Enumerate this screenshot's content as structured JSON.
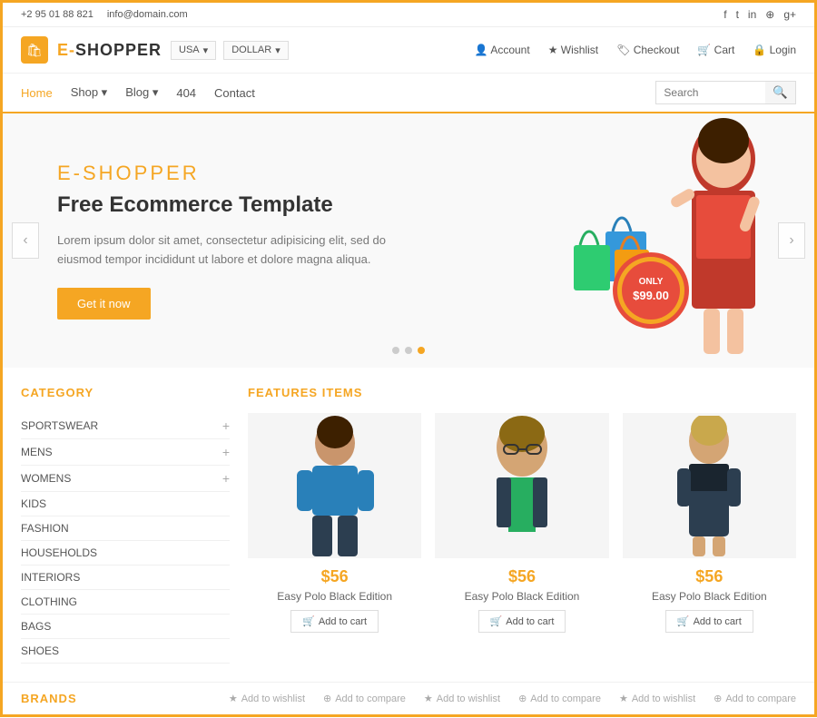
{
  "topbar": {
    "phone": "+2 95 01 88 821",
    "email": "info@domain.com",
    "social": [
      "f",
      "t",
      "in",
      "⊕",
      "g+"
    ]
  },
  "header": {
    "logo": "E-SHOPPER",
    "logo_prefix": "E-",
    "logo_suffix": "SHOPPER",
    "country": "USA",
    "currency": "DOLLAR",
    "nav": [
      {
        "label": "Account",
        "icon": "👤"
      },
      {
        "label": "Wishlist",
        "icon": "★"
      },
      {
        "label": "Checkout",
        "icon": "🏷"
      },
      {
        "label": "Cart",
        "icon": "🛒"
      },
      {
        "label": "Login",
        "icon": "🔒"
      }
    ]
  },
  "navbar": {
    "links": [
      {
        "label": "Home",
        "active": true
      },
      {
        "label": "Shop",
        "dropdown": true
      },
      {
        "label": "Blog",
        "dropdown": true
      },
      {
        "label": "404"
      },
      {
        "label": "Contact"
      }
    ],
    "search_placeholder": "Search"
  },
  "hero": {
    "brand": "E-SHOPPER",
    "title": "Free Ecommerce Template",
    "description": "Lorem ipsum dolor sit amet, consectetur adipisicing elit, sed do eiusmod tempor incididunt ut labore et dolore magna aliqua.",
    "cta": "Get it now",
    "price_label": "ONLY",
    "price": "$99.00",
    "dots": [
      1,
      2,
      3
    ],
    "active_dot": 3
  },
  "category": {
    "title": "CATEGORY",
    "items": [
      {
        "label": "SPORTSWEAR",
        "has_plus": true
      },
      {
        "label": "MENS",
        "has_plus": true
      },
      {
        "label": "WOMENS",
        "has_plus": true
      },
      {
        "label": "KIDS",
        "has_plus": false
      },
      {
        "label": "FASHION",
        "has_plus": false
      },
      {
        "label": "HOUSEHOLDS",
        "has_plus": false
      },
      {
        "label": "INTERIORS",
        "has_plus": false
      },
      {
        "label": "CLOTHING",
        "has_plus": false
      },
      {
        "label": "BAGS",
        "has_plus": false
      },
      {
        "label": "SHOES",
        "has_plus": false
      }
    ]
  },
  "featured": {
    "title": "FEATURES ITEMS",
    "products": [
      {
        "price": "$56",
        "name": "Easy Polo Black Edition",
        "cta": "Add to cart",
        "figure": "woman1"
      },
      {
        "price": "$56",
        "name": "Easy Polo Black Edition",
        "cta": "Add to cart",
        "figure": "man"
      },
      {
        "price": "$56",
        "name": "Easy Polo Black Edition",
        "cta": "Add to cart",
        "figure": "woman2"
      }
    ]
  },
  "bottom": {
    "brands_title": "BRANDS",
    "actions": [
      {
        "icon": "★",
        "label": "Add to wishlist"
      },
      {
        "icon": "⊕",
        "label": "Add to compare"
      },
      {
        "icon": "★",
        "label": "Add to wishlist"
      },
      {
        "icon": "⊕",
        "label": "Add to compare"
      },
      {
        "icon": "★",
        "label": "Add to wishlist"
      },
      {
        "icon": "⊕",
        "label": "Add to compare"
      }
    ]
  }
}
